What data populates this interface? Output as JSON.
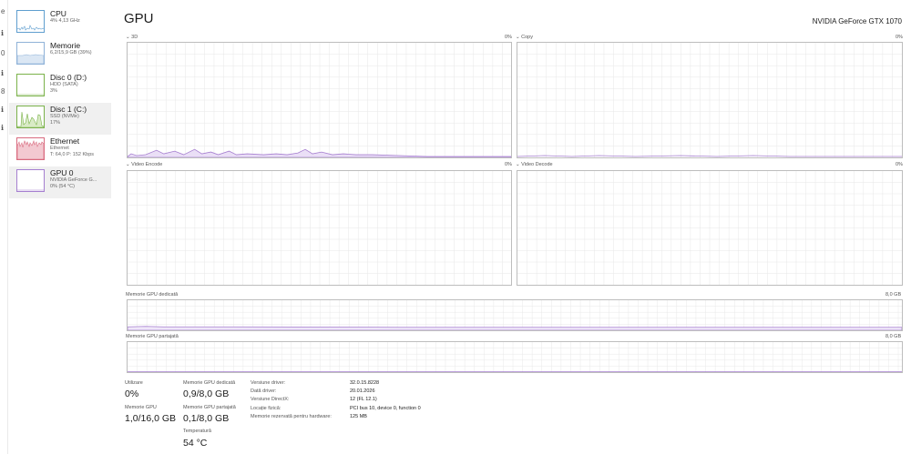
{
  "colors": {
    "gpu_purple": "#a67fd0",
    "disk_green": "#7bb24a",
    "ethernet_red": "#d96b7f",
    "cpu_blue": "#5f9ecf",
    "grid": "#e7e7e7",
    "border": "#bdbdbd"
  },
  "sidebar": {
    "items": [
      {
        "title": "CPU",
        "line1": "4% 4,13 GHz",
        "line2": "",
        "icon": "cpu-graph-thumbnail"
      },
      {
        "title": "Memorie",
        "line1": "6,2/15,9 GB (39%)",
        "line2": "",
        "icon": "memory-graph-thumbnail"
      },
      {
        "title": "Disc 0 (D:)",
        "line1": "HDD (SATA)",
        "line2": "3%",
        "icon": "disk-graph-thumbnail"
      },
      {
        "title": "Disc 1 (C:)",
        "line1": "SSD (NVMe)",
        "line2": "17%",
        "icon": "disk-graph-thumbnail"
      },
      {
        "title": "Ethernet",
        "line1": "Ethernet",
        "line2": "T: 64,0 P: 152 Kbps",
        "icon": "ethernet-graph-thumbnail"
      },
      {
        "title": "GPU 0",
        "line1": "NVIDIA GeForce G...",
        "line2": "0% (54 °C)",
        "icon": "gpu-graph-thumbnail"
      }
    ]
  },
  "header": {
    "title": "GPU",
    "model": "NVIDIA GeForce GTX 1070"
  },
  "engines": [
    {
      "name": "3D",
      "percent": "0%"
    },
    {
      "name": "Copy",
      "percent": "0%"
    },
    {
      "name": "Video Encode",
      "percent": "0%"
    },
    {
      "name": "Video Decode",
      "percent": "0%"
    }
  ],
  "memory_charts": {
    "dedicated": {
      "label": "Memorie GPU dedicată",
      "max": "8,0 GB"
    },
    "shared": {
      "label": "Memorie GPU partajată",
      "max": "8,0 GB"
    }
  },
  "stats": {
    "utilization": {
      "label": "Utilizare",
      "value": "0%"
    },
    "gpu_memory": {
      "label": "Memorie GPU",
      "value": "1,0/16,0 GB"
    },
    "dedicated": {
      "label": "Memorie GPU dedicată",
      "value": "0,9/8,0 GB"
    },
    "shared": {
      "label": "Memorie GPU partajată",
      "value": "0,1/8,0 GB"
    },
    "temperature": {
      "label": "Temperatură",
      "value": "54 °C"
    }
  },
  "info": [
    {
      "label": "Versiune driver:",
      "value": "32.0.15.8228"
    },
    {
      "label": "Dată driver:",
      "value": "20.01.2026"
    },
    {
      "label": "Versiune DirectX:",
      "value": "12 (FL 12.1)"
    },
    {
      "label": "Locație fizică:",
      "value": "PCI bus 10, device 0, function 0"
    },
    {
      "label": "Memorie rezervată pentru hardware:",
      "value": "125 MB"
    }
  ]
}
